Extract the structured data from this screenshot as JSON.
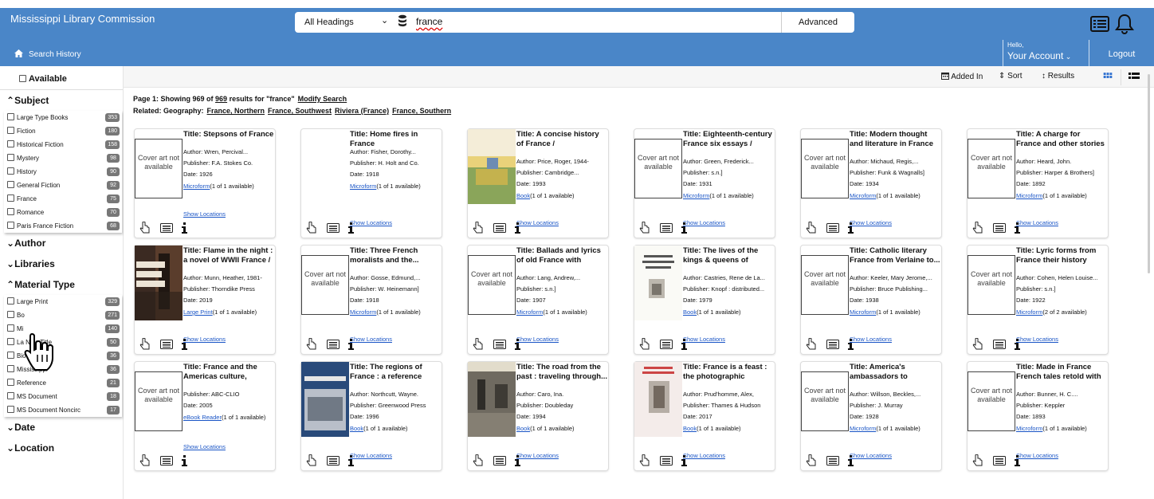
{
  "header": {
    "brand": "Mississippi Library Commission",
    "scope": "All Headings",
    "query": "france",
    "advanced": "Advanced",
    "history": "Search History",
    "account_hello": "Hello,",
    "account_label": "Your Account",
    "logout": "Logout"
  },
  "sidebar": {
    "available": "Available",
    "subject": {
      "title": "Subject",
      "items": [
        {
          "label": "Large Type Books",
          "count": "353"
        },
        {
          "label": "Fiction",
          "count": "180"
        },
        {
          "label": "Historical Fiction",
          "count": "158"
        },
        {
          "label": "Mystery",
          "count": "98"
        },
        {
          "label": "History",
          "count": "90"
        },
        {
          "label": "General Fiction",
          "count": "92"
        },
        {
          "label": "France",
          "count": "75"
        },
        {
          "label": "Romance",
          "count": "70"
        },
        {
          "label": "Paris France Fiction",
          "count": "68"
        }
      ]
    },
    "author": "Author",
    "libraries": "Libraries",
    "material": {
      "title": "Material Type",
      "items": [
        {
          "label": "Large Print",
          "count": "329"
        },
        {
          "label": "Bo",
          "count": "271"
        },
        {
          "label": "Mi",
          "count": "140"
        },
        {
          "label": "La        New Title",
          "count": "50"
        },
        {
          "label": "Bio",
          "count": "36"
        },
        {
          "label": "Mississippi",
          "count": "36"
        },
        {
          "label": "Reference",
          "count": "21"
        },
        {
          "label": "MS Document",
          "count": "18"
        },
        {
          "label": "MS Document Noncirc",
          "count": "17"
        }
      ]
    },
    "date": "Date",
    "location": "Location"
  },
  "toolbar": {
    "added": "Added In",
    "sort": "Sort",
    "results": "Results"
  },
  "results": {
    "prefix": "Page 1: Showing 969 of",
    "total": "969",
    "suffix": "results for \"france\"",
    "modify": "Modify Search",
    "related_label": "Related: Geography:",
    "related": [
      "France, Northern",
      "France, Southwest",
      "Riviera (France)",
      "France, Southern"
    ]
  },
  "cards": [
    {
      "title": "Title: Stepsons of France",
      "author": "Author: Wren, Percival...",
      "publisher": "Publisher: F.A. Stokes Co.",
      "date": "Date: 1926",
      "format": "Microform",
      "avail": "(1 of 1 available)",
      "cover": "Cover art not available"
    },
    {
      "title": "Title: Home fires in France",
      "author": "Author: Fisher, Dorothy...",
      "publisher": "Publisher: H. Holt and Co.",
      "date": "Date: 1918",
      "format": "Microform",
      "avail": "(1 of 1 available)",
      "cover": ""
    },
    {
      "title": "Title: A concise history of France /",
      "author": "Author: Price, Roger, 1944-",
      "publisher": "Publisher: Cambridge...",
      "date": "Date: 1993",
      "format": "Book",
      "avail": "(1 of 1 available)",
      "cover": "img1"
    },
    {
      "title": "Title: Eighteenth-century France six essays /",
      "author": "Author: Green, Frederick...",
      "publisher": "Publisher: s.n.]",
      "date": "Date: 1931",
      "format": "Microform",
      "avail": "(1 of 1 available)",
      "cover": "Cover art not available"
    },
    {
      "title": "Title: Modern thought and literature in France",
      "author": "Author: Michaud, Regis,...",
      "publisher": "Publisher: Funk & Wagnalls]",
      "date": "Date: 1934",
      "format": "Microform",
      "avail": "(1 of 1 available)",
      "cover": "Cover art not available"
    },
    {
      "title": "Title: A charge for France and other stories /",
      "author": "Author: Heard, John.",
      "publisher": "Publisher: Harper & Brothers]",
      "date": "Date: 1892",
      "format": "Microform",
      "avail": "(1 of 1 available)",
      "cover": "Cover art not available"
    },
    {
      "title": "Title: Flame in the night : a novel of WWII France /",
      "author": "Author: Munn, Heather, 1981-",
      "publisher": "Publisher: Thorndike Press",
      "date": "Date: 2019",
      "format": "Large Print",
      "avail": "(1 of 1 available)",
      "cover": "img2"
    },
    {
      "title": "Title: Three French moralists and the...",
      "author": "Author: Gosse, Edmund,...",
      "publisher": "Publisher: W. Heinemann]",
      "date": "Date: 1918",
      "format": "Microform",
      "avail": "(1 of 1 available)",
      "cover": "Cover art not available"
    },
    {
      "title": "Title: Ballads and lyrics of old France with other...",
      "author": "Author: Lang, Andrew,...",
      "publisher": "Publisher: s.n.]",
      "date": "Date: 1907",
      "format": "Microform",
      "avail": "(1 of 1 available)",
      "cover": "Cover art not available"
    },
    {
      "title": "Title: The lives of the kings & queens of Franc...",
      "author": "Author: Castries, Rene de La...",
      "publisher": "Publisher: Knopf : distributed...",
      "date": "Date: 1979",
      "format": "Book",
      "avail": "(1 of 1 available)",
      "cover": "img3"
    },
    {
      "title": "Title: Catholic literary France from Verlaine to...",
      "author": "Author: Keeler, Mary Jerome,...",
      "publisher": "Publisher: Bruce Publishing...",
      "date": "Date: 1938",
      "format": "Microform",
      "avail": "(1 of 1 available)",
      "cover": "Cover art not available"
    },
    {
      "title": "Title: Lyric forms from France their history and...",
      "author": "Author: Cohen, Helen Louise...",
      "publisher": "Publisher: s.n.]",
      "date": "Date: 1922",
      "format": "Microform",
      "avail": "(2 of 2 available)",
      "cover": "Cover art not available"
    },
    {
      "title": "Title: France and the Americas culture, politic...",
      "author": "",
      "publisher": "Publisher: ABC-CLIO",
      "date": "Date: 2005",
      "format": "eBook Reader",
      "avail": "(1 of 1 available)",
      "cover": "Cover art not available"
    },
    {
      "title": "Title: The regions of France : a reference gui...",
      "author": "Author: Northcutt, Wayne.",
      "publisher": "Publisher: Greenwood Press",
      "date": "Date: 1996",
      "format": "Book",
      "avail": "(1 of 1 available)",
      "cover": "img4"
    },
    {
      "title": "Title: The road from the past : traveling through...",
      "author": "Author: Caro, Ina.",
      "publisher": "Publisher: Doubleday",
      "date": "Date: 1994",
      "format": "Book",
      "avail": "(1 of 1 available)",
      "cover": "img5"
    },
    {
      "title": "Title: France is a feast : the photographic journe...",
      "author": "Author: Prud'homme, Alex,",
      "publisher": "Publisher: Thames & Hudson",
      "date": "Date: 2017",
      "format": "Book",
      "avail": "(1 of 1 available)",
      "cover": "img6"
    },
    {
      "title": "Title: America's ambassadors to France...",
      "author": "Author: Willson, Beckles,...",
      "publisher": "Publisher: J. Murray",
      "date": "Date: 1928",
      "format": "Microform",
      "avail": "(1 of 1 available)",
      "cover": "Cover art not available"
    },
    {
      "title": "Title: Made in France French tales retold with ...",
      "author": "Author: Bunner, H. C....",
      "publisher": "Publisher: Keppler",
      "date": "Date: 1893",
      "format": "Microform",
      "avail": "(1 of 1 available)",
      "cover": "Cover art not available"
    }
  ],
  "show_locations": "Show Locations"
}
